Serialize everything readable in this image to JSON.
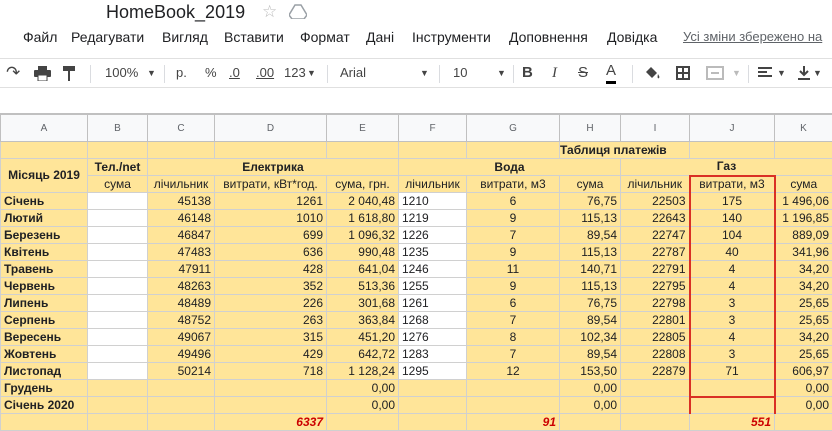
{
  "app": {
    "title": "HomeBook_2019"
  },
  "menu": {
    "items": [
      "Файл",
      "Редагувати",
      "Вигляд",
      "Вставити",
      "Формат",
      "Дані",
      "Інструменти",
      "Доповнення",
      "Довідка"
    ],
    "saved": "Усі зміни збережено на"
  },
  "toolbar": {
    "zoom": "100%",
    "currency": "р.",
    "percent": "%",
    "dec_less": ".0",
    "dec_more": ".00",
    "number_format": "123",
    "font": "Arial",
    "font_size": "10",
    "bold": "B",
    "italic": "I",
    "strike": "S",
    "text_color": "A"
  },
  "columns": [
    "A",
    "B",
    "C",
    "D",
    "E",
    "F",
    "G",
    "H",
    "I",
    "J",
    "K"
  ],
  "sheet": {
    "table_title": "Таблиця платежів",
    "month_header": "Місяць 2019",
    "tel_header": "Тел./net",
    "elec_header": "Електрика",
    "water_header": "Вода",
    "gas_header": "Газ",
    "sub": [
      "сума",
      "лічильник",
      "витрати, кВт*год.",
      "сума, грн.",
      "лічильник",
      "витрати, м3",
      "сума",
      "лічильник",
      "витрати, м3",
      "сума"
    ],
    "rows": [
      [
        "Січень",
        "",
        "45138",
        "1261",
        "2 040,48",
        "1210",
        "6",
        "76,75",
        "22503",
        "175",
        "1 496,06"
      ],
      [
        "Лютий",
        "",
        "46148",
        "1010",
        "1 618,80",
        "1219",
        "9",
        "115,13",
        "22643",
        "140",
        "1 196,85"
      ],
      [
        "Березень",
        "",
        "46847",
        "699",
        "1 096,32",
        "1226",
        "7",
        "89,54",
        "22747",
        "104",
        "889,09"
      ],
      [
        "Квітень",
        "",
        "47483",
        "636",
        "990,48",
        "1235",
        "9",
        "115,13",
        "22787",
        "40",
        "341,96"
      ],
      [
        "Травень",
        "",
        "47911",
        "428",
        "641,04",
        "1246",
        "11",
        "140,71",
        "22791",
        "4",
        "34,20"
      ],
      [
        "Червень",
        "",
        "48263",
        "352",
        "513,36",
        "1255",
        "9",
        "115,13",
        "22795",
        "4",
        "34,20"
      ],
      [
        "Липень",
        "",
        "48489",
        "226",
        "301,68",
        "1261",
        "6",
        "76,75",
        "22798",
        "3",
        "25,65"
      ],
      [
        "Серпень",
        "",
        "48752",
        "263",
        "363,84",
        "1268",
        "7",
        "89,54",
        "22801",
        "3",
        "25,65"
      ],
      [
        "Вересень",
        "",
        "49067",
        "315",
        "451,20",
        "1276",
        "8",
        "102,34",
        "22805",
        "4",
        "34,20"
      ],
      [
        "Жовтень",
        "",
        "49496",
        "429",
        "642,72",
        "1283",
        "7",
        "89,54",
        "22808",
        "3",
        "25,65"
      ],
      [
        "Листопад",
        "",
        "50214",
        "718",
        "1 128,24",
        "1295",
        "12",
        "153,50",
        "22879",
        "71",
        "606,97"
      ],
      [
        "Грудень",
        "",
        "",
        "",
        "0,00",
        "",
        "",
        "0,00",
        "",
        "",
        "0,00"
      ],
      [
        "Січень 2020",
        "",
        "",
        "",
        "0,00",
        "",
        "",
        "0,00",
        "",
        "",
        "0,00"
      ]
    ],
    "totals": {
      "elec": "6337",
      "water": "91",
      "gas": "551"
    }
  }
}
